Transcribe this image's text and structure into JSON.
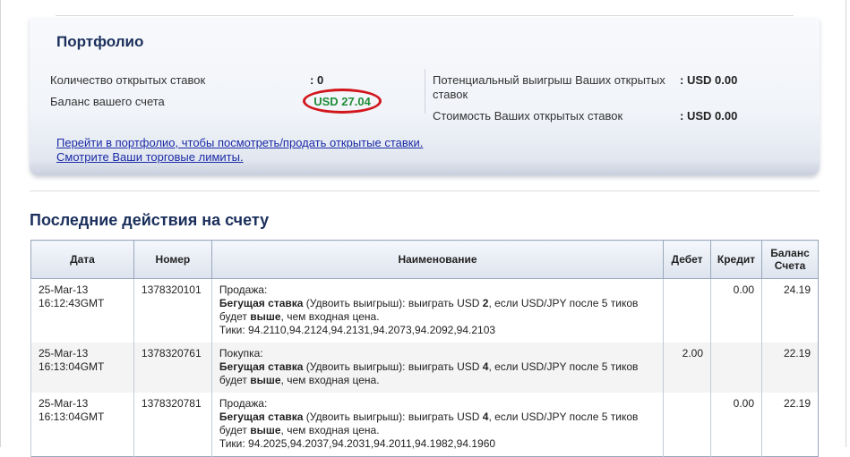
{
  "portfolio": {
    "title": "Портфолио",
    "open_bets_label": "Количество открытых ставок",
    "open_bets_value": ": 0",
    "balance_label": "Баланс вашего счета",
    "balance_value": "USD 27.04",
    "potential_label": "Потенциальный выигрыш Ваших открытых ставок",
    "potential_value": ": USD 0.00",
    "cost_label": "Стоимость Ваших открытых ставок",
    "cost_value": ": USD 0.00",
    "link_portfolio": "Перейти в портфолио, чтобы посмотреть/продать открытые ставки.",
    "link_limits": "Смотрите Ваши торговые лимиты."
  },
  "activity": {
    "title": "Последние действия на счету",
    "headers": {
      "date": "Дата",
      "number": "Номер",
      "name": "Наименование",
      "debit": "Дебет",
      "credit": "Кредит",
      "balance_l1": "Баланс",
      "balance_l2": "Счета"
    },
    "rows": [
      {
        "date_day": "25-Mar-13",
        "date_time": "16:12:43GMT",
        "number": "1378320101",
        "action": "Продажа:",
        "bet_type": "Бегущая ставка",
        "line1_rest": " (Удвоить выигрыш): выиграть USD ",
        "amount": "2",
        "line1_end": ", если USD/JPY после 5 тиков",
        "line2_start": "будет ",
        "direction": "выше",
        "line2_end": ", чем входная цена.",
        "ticks": "Тики: 94.2110,94.2124,94.2131,94.2073,94.2092,94.2103",
        "debit": "",
        "credit": "0.00",
        "balance": "24.19"
      },
      {
        "date_day": "25-Mar-13",
        "date_time": "16:13:04GMT",
        "number": "1378320761",
        "action": "Покупка:",
        "bet_type": "Бегущая ставка",
        "line1_rest": " (Удвоить выигрыш): выиграть USD ",
        "amount": "4",
        "line1_end": ", если USD/JPY после 5 тиков",
        "line2_start": "будет ",
        "direction": "выше",
        "line2_end": ", чем входная цена.",
        "ticks": "",
        "debit": "2.00",
        "credit": "",
        "balance": "22.19"
      },
      {
        "date_day": "25-Mar-13",
        "date_time": "16:13:04GMT",
        "number": "1378320781",
        "action": "Продажа:",
        "bet_type": "Бегущая ставка",
        "line1_rest": " (Удвоить выигрыш): выиграть USD ",
        "amount": "4",
        "line1_end": ", если USD/JPY после 5 тиков",
        "line2_start": "будет ",
        "direction": "выше",
        "line2_end": ", чем входная цена.",
        "ticks": "Тики: 94.2025,94.2037,94.2031,94.2011,94.1982,94.1960",
        "debit": "",
        "credit": "0.00",
        "balance": "22.19"
      }
    ]
  }
}
